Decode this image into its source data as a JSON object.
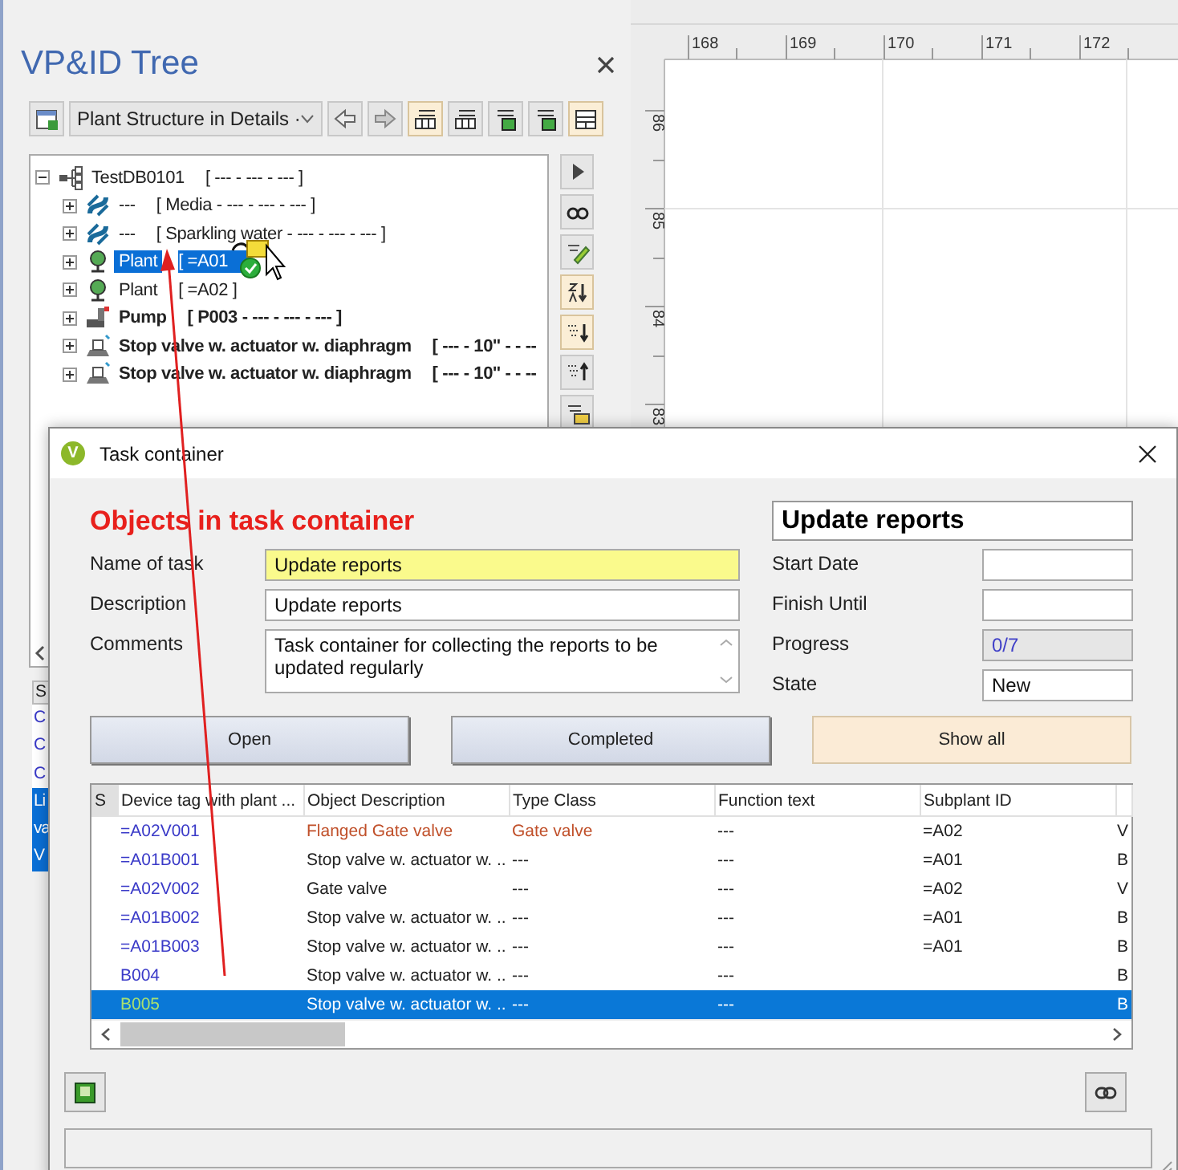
{
  "panel": {
    "title": "VP&ID Tree"
  },
  "toolbar": [
    {
      "kind": "new",
      "on": false
    },
    {
      "kind": "select",
      "text": "Plant Structure in Details ·"
    },
    {
      "kind": "back",
      "on": false
    },
    {
      "kind": "forward",
      "on": false
    },
    {
      "kind": "list",
      "on": true
    },
    {
      "kind": "list",
      "on": false
    },
    {
      "kind": "add",
      "on": false
    },
    {
      "kind": "add",
      "on": false
    },
    {
      "kind": "grid",
      "on": true
    }
  ],
  "tree": {
    "name": "TestDB0101",
    "detail": "[ --- - --- - --- ]",
    "kind": "network",
    "bold": false,
    "selected": false,
    "expanded": true,
    "children": [
      {
        "name": "---",
        "detail": "[ Media - --- - --- - --- ]",
        "kind": "media",
        "bold": false,
        "selected": false,
        "expanded": false
      },
      {
        "name": "---",
        "detail": "[ Sparkling water - --- - --- - --- ]",
        "kind": "media",
        "bold": false,
        "selected": false,
        "expanded": false
      },
      {
        "name": "Plant",
        "detail": "[ =A01",
        "kind": "plant",
        "bold": false,
        "selected": true,
        "expanded": false
      },
      {
        "name": "Plant",
        "detail": "[ =A02 ]",
        "kind": "plant",
        "bold": false,
        "selected": false,
        "expanded": false
      },
      {
        "name": "Pump",
        "detail": "[ P003 - --- - --- - --- ]",
        "kind": "pump",
        "bold": true,
        "selected": false,
        "expanded": false
      },
      {
        "name": "Stop valve w. actuator w. diaphragm",
        "detail": "[ --- - 10'' - - --",
        "kind": "valve",
        "bold": true,
        "selected": false,
        "expanded": false
      },
      {
        "name": "Stop valve w. actuator w. diaphragm",
        "detail": "[ --- - 10'' - - --",
        "kind": "valve",
        "bold": true,
        "selected": false,
        "expanded": false
      }
    ]
  },
  "side_tools": [
    {
      "kind": "play",
      "on": false
    },
    {
      "kind": "find",
      "on": false
    },
    {
      "kind": "edit",
      "on": false
    },
    {
      "kind": "sort",
      "on": true
    },
    {
      "kind": "down",
      "on": true
    },
    {
      "kind": "up",
      "on": false
    },
    {
      "kind": "layers",
      "on": false
    }
  ],
  "lower_list": {
    "header": "S",
    "items": [
      {
        "text": "C",
        "selected": false
      },
      {
        "text": "C",
        "selected": false
      },
      {
        "text": "C",
        "selected": false
      },
      {
        "text": "Li",
        "selected": true
      },
      {
        "text": "va",
        "selected": true
      },
      {
        "text": "V",
        "selected": true
      }
    ]
  },
  "canvas": {
    "x_ticks": [
      "168",
      "169",
      "170",
      "171",
      "172"
    ],
    "y_ticks": [
      "86",
      "85",
      "84",
      "83"
    ]
  },
  "dialog": {
    "title": "Task container",
    "app_icon": "V",
    "heading": "Objects in task container",
    "task_title": "Update reports",
    "fields": [
      {
        "label": "Name of task",
        "value": "Update reports",
        "kind": "line",
        "highlighted": true
      },
      {
        "label": "Description",
        "value": "Update reports",
        "kind": "line",
        "highlighted": false
      },
      {
        "label": "Comments",
        "value": "Task container for collecting the reports to be updated regularly",
        "kind": "multiline",
        "highlighted": false
      }
    ],
    "side_fields": [
      {
        "label": "Start Date",
        "readonly": false
      },
      {
        "label": "Finish Until",
        "readonly": false
      },
      {
        "label": "Progress",
        "value": "0/7",
        "readonly": true
      },
      {
        "label": "State",
        "value": "New",
        "readonly": false
      }
    ],
    "filters": [
      {
        "label": "Open",
        "selected": false
      },
      {
        "label": "Completed",
        "selected": false
      },
      {
        "label": "Show all",
        "selected": true
      }
    ],
    "table": {
      "columns": [
        "S",
        "Device tag with plant ...",
        "Object Description",
        "Type Class",
        "Function text",
        "Subplant ID"
      ],
      "rows": [
        {
          "tag": "=A02V001",
          "description": "Flanged Gate valve",
          "type_class": "Gate valve",
          "function_text": "---",
          "subplant": "=A02",
          "column_7": "V",
          "flagged": true,
          "selected": false
        },
        {
          "tag": "=A01B001",
          "description": "Stop valve w. actuator w. ..",
          "type_class": "---",
          "function_text": "---",
          "subplant": "=A01",
          "column_7": "B",
          "flagged": false,
          "selected": false
        },
        {
          "tag": "=A02V002",
          "description": "Gate valve",
          "type_class": "---",
          "function_text": "---",
          "subplant": "=A02",
          "column_7": "V",
          "flagged": false,
          "selected": false
        },
        {
          "tag": "=A01B002",
          "description": "Stop valve w. actuator w. ..",
          "type_class": "---",
          "function_text": "---",
          "subplant": "=A01",
          "column_7": "B",
          "flagged": false,
          "selected": false
        },
        {
          "tag": "=A01B003",
          "description": "Stop valve w. actuator w. ..",
          "type_class": "---",
          "function_text": "---",
          "subplant": "=A01",
          "column_7": "B",
          "flagged": false,
          "selected": false
        },
        {
          "tag": "B004",
          "description": "Stop valve w. actuator w. ..",
          "type_class": "---",
          "function_text": "---",
          "column_7": "B",
          "flagged": false,
          "selected": false
        },
        {
          "tag": "B005",
          "description": "Stop valve w. actuator w. ..",
          "type_class": "---",
          "function_text": "---",
          "column_7": "B",
          "flagged": false,
          "selected": true
        }
      ]
    }
  }
}
